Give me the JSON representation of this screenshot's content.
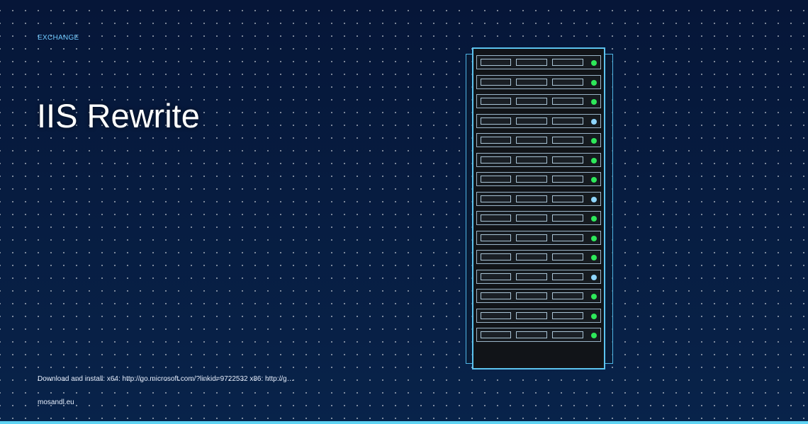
{
  "post": {
    "category": "EXCHANGE",
    "title": "IIS Rewrite",
    "excerpt": "Download and install: x64: http://go.microsoft.com/?linkid=9722532 x86: http://g…",
    "site": "mosandl.eu"
  },
  "illustration": {
    "name": "server-rack",
    "led_status": [
      "green",
      "green",
      "green",
      "blue",
      "green",
      "green",
      "green",
      "blue",
      "green",
      "green",
      "green",
      "blue",
      "green",
      "green",
      "green"
    ]
  },
  "colors": {
    "background": "#071a3a",
    "accent": "#5fd3f3",
    "category": "#6ec9ff",
    "led_green": "#2ee85a",
    "led_blue": "#8fd6ff"
  }
}
